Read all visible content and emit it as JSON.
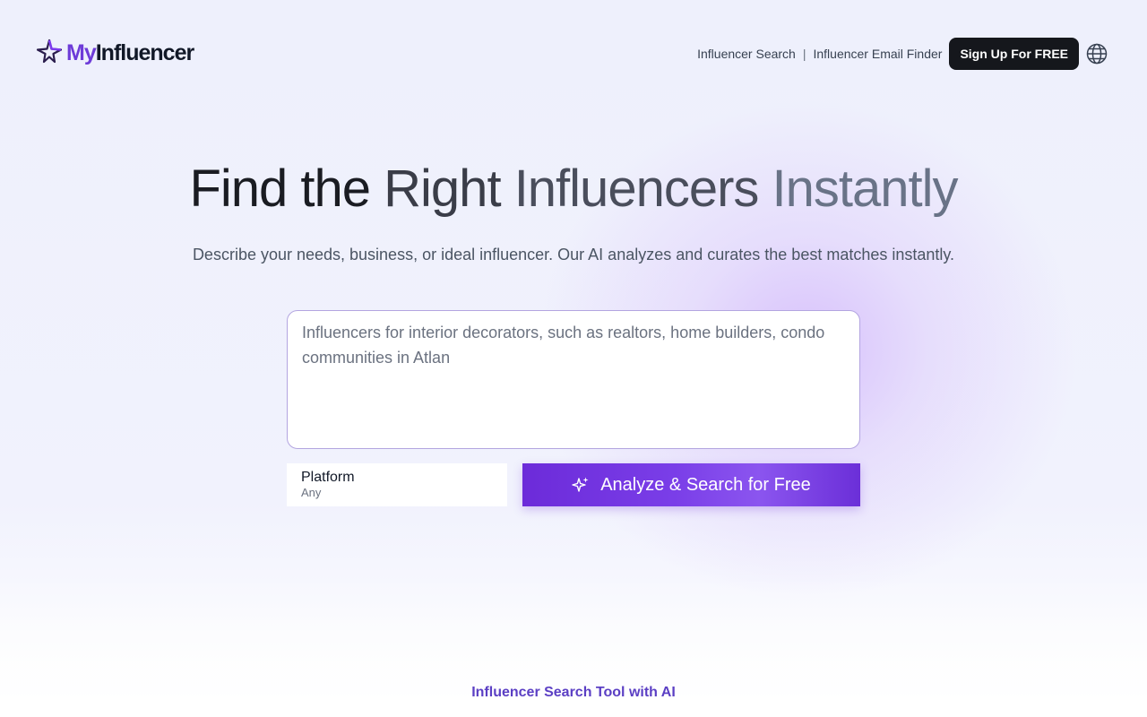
{
  "brand": {
    "name_part1": "My",
    "name_part2": "Influencer",
    "logo_icon": "star-logo-icon"
  },
  "nav": {
    "links": [
      {
        "label": "Influencer Search"
      },
      {
        "label": "Influencer Email Finder"
      }
    ],
    "separator": "|",
    "signup_label": "Sign Up For FREE",
    "language_icon": "globe-icon"
  },
  "hero": {
    "title_words": [
      "Find the",
      "Right",
      "Influencers",
      "Instantly"
    ],
    "subtitle": "Describe your needs, business, or ideal influencer. Our AI analyzes and curates the best matches instantly."
  },
  "search": {
    "query_value": "Influencers for interior decorators, such as realtors, home builders, condo communities in Atlan",
    "platform_label": "Platform",
    "platform_value": "Any",
    "submit_label": "Analyze & Search for Free",
    "submit_icon": "sparkle-icon"
  },
  "section": {
    "title": "Influencer Search Tool with AI"
  },
  "colors": {
    "accent": "#6c2bd9",
    "signup_bg": "#15171c",
    "section_title": "#5b3fc4"
  }
}
